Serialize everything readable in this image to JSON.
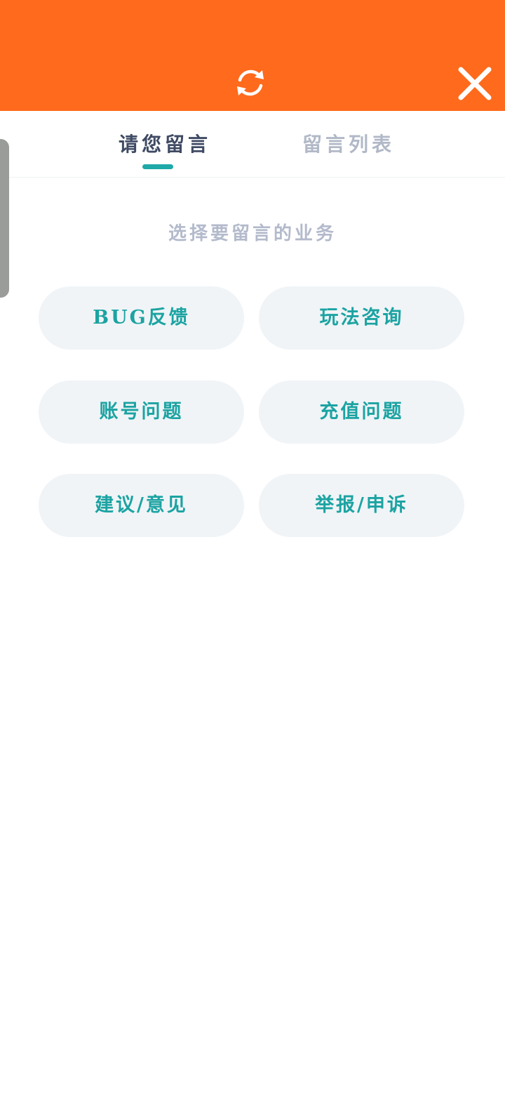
{
  "header": {
    "refresh_icon": "refresh-icon",
    "close_icon": "close-icon",
    "bar_color": "#ff6a1c"
  },
  "tabs": [
    {
      "label": "请您留言",
      "active": true
    },
    {
      "label": "留言列表",
      "active": false
    }
  ],
  "main": {
    "section_title": "选择要留言的业务",
    "options": [
      {
        "label": "BUG反馈"
      },
      {
        "label": "玩法咨询"
      },
      {
        "label": "账号问题"
      },
      {
        "label": "充值问题"
      },
      {
        "label": "建议/意见"
      },
      {
        "label": "举报/申诉"
      }
    ]
  },
  "colors": {
    "accent": "#1fa9a8",
    "option_bg": "#f0f4f7",
    "active_tab": "#3f4a63",
    "inactive_tab": "#b1b8c7"
  }
}
